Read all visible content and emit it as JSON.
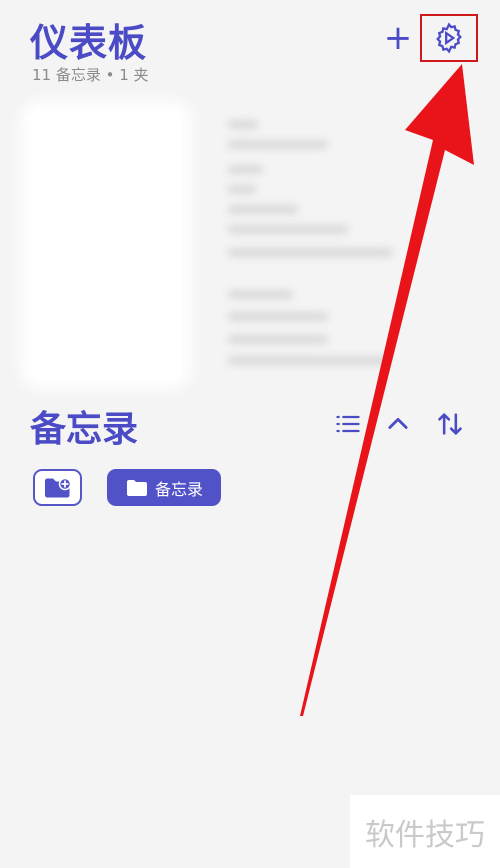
{
  "header": {
    "title": "仪表板",
    "subtitle": "11 备忘录 • 1 夹",
    "add_label": "+"
  },
  "section": {
    "title": "备忘录"
  },
  "folders": [
    {
      "label": "备忘录",
      "icon": "folder-icon"
    }
  ],
  "icons": {
    "settings": "gear-icon",
    "add": "plus-icon",
    "list": "list-icon",
    "collapse": "chevron-up-icon",
    "sort": "sort-icon",
    "new_folder": "new-folder-icon"
  },
  "watermark": "软件技巧",
  "colors": {
    "accent": "#4b4bc6",
    "highlight": "#d0191b",
    "arrow": "#e8141a"
  }
}
